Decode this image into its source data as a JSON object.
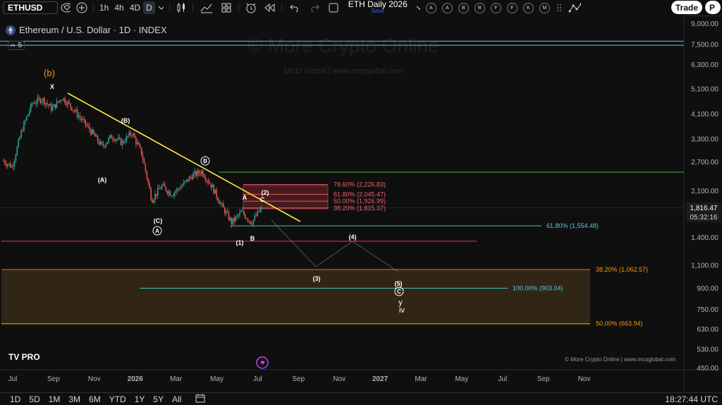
{
  "toolbar": {
    "symbol": "ETHUSD",
    "intervals": [
      "1h",
      "4h",
      "4D",
      "D"
    ],
    "layout_name": "ETH Daily 2026",
    "layout_status": "Save",
    "alert_buttons": [
      "A",
      "A",
      "B",
      "B",
      "F",
      "F",
      "K",
      "M"
    ],
    "trade_label": "Trade",
    "profile_label": "P",
    "icons": [
      "gem-icon",
      "add-compare-icon",
      "chevron-down-icon",
      "candles-icon",
      "indicators-icon",
      "templates-icon",
      "alert-icon",
      "replay-icon",
      "undo-icon",
      "redo-icon",
      "layout-icon",
      "chevron-down-icon",
      "dots-grid-icon",
      "trend-icon"
    ]
  },
  "legend": {
    "title": "Ethereum / U.S. Dollar · 1D · INDEX",
    "indicator_count": "5"
  },
  "watermark": {
    "main": "© More Crypto Online",
    "sub": "MCO Global  |  www.mcoglobal.com"
  },
  "chart_data": {
    "type": "candlestick",
    "title": "Ethereum / U.S. Dollar · 1D · INDEX",
    "y_scale": "log",
    "ylim": [
      440,
      9400
    ],
    "x_ticks": [
      "Jul",
      "Sep",
      "Nov",
      "2026",
      "Mar",
      "May",
      "Jul",
      "Sep",
      "Nov",
      "2027",
      "Mar",
      "May",
      "Jul",
      "Sep",
      "Nov"
    ],
    "y_ticks": [
      "9,000.00",
      "7,500.00",
      "6,300.00",
      "5,100.00",
      "4,100.00",
      "3,300.00",
      "2,700.00",
      "2,100.00",
      "1,400.00",
      "1,100.00",
      "900.00",
      "750.00",
      "630.00",
      "530.00",
      "450.00"
    ],
    "y_tick_values": [
      9000,
      7500,
      6300,
      5100,
      4100,
      3300,
      2700,
      2100,
      1400,
      1100,
      900,
      750,
      630,
      530,
      450
    ],
    "current_price": {
      "label": "1,816.47",
      "countdown": "05:32:16",
      "value": 1816.47
    },
    "price_path": [
      {
        "t": 0,
        "p": 2750
      },
      {
        "t": 1,
        "p": 2600
      },
      {
        "t": 2,
        "p": 3600
      },
      {
        "t": 3,
        "p": 4500
      },
      {
        "t": 4,
        "p": 4700
      },
      {
        "t": 5,
        "p": 4300
      },
      {
        "t": 6,
        "p": 4750
      },
      {
        "t": 7,
        "p": 4350
      },
      {
        "t": 8,
        "p": 3900
      },
      {
        "t": 9,
        "p": 3500
      },
      {
        "t": 10,
        "p": 3100
      },
      {
        "t": 11,
        "p": 3400
      },
      {
        "t": 12,
        "p": 3200
      },
      {
        "t": 13,
        "p": 3500
      },
      {
        "t": 14,
        "p": 2900
      },
      {
        "t": 15,
        "p": 1950
      },
      {
        "t": 16,
        "p": 2200
      },
      {
        "t": 17,
        "p": 2050
      },
      {
        "t": 18,
        "p": 2200
      },
      {
        "t": 19,
        "p": 2400
      },
      {
        "t": 20,
        "p": 2500
      },
      {
        "t": 21,
        "p": 2200
      },
      {
        "t": 22,
        "p": 1850
      },
      {
        "t": 23,
        "p": 1600
      },
      {
        "t": 24,
        "p": 1750
      },
      {
        "t": 25,
        "p": 1600
      },
      {
        "t": 26,
        "p": 1816
      }
    ],
    "fib_levels": [
      {
        "label": "78.60% (2,226.83)",
        "value": 2226.83,
        "color": "#f06070"
      },
      {
        "label": "61.80% (2,045.47)",
        "value": 2045.47,
        "color": "#f06070"
      },
      {
        "label": "50.00% (1,926.99)",
        "value": 1926.99,
        "color": "#f06070"
      },
      {
        "label": "38.20% (1,815.37)",
        "value": 1815.37,
        "color": "#f06070"
      },
      {
        "label": "61.80% (1,554.48)",
        "value": 1554.48,
        "color": "#4dd0e1"
      },
      {
        "label": "38.20% (1,062.57)",
        "value": 1062.57,
        "color": "#ff9800"
      },
      {
        "label": "100.00% (903.04)",
        "value": 903.04,
        "color": "#4dd0e1"
      },
      {
        "label": "50.00% (663.94)",
        "value": 663.94,
        "color": "#ff9800"
      }
    ],
    "horizontal_lines": [
      {
        "value": 7750,
        "color": "#4dd0e1"
      },
      {
        "value": 7480,
        "color": "#4dd0e1"
      },
      {
        "value": 2480,
        "color": "#4caf50"
      },
      {
        "value": 1360,
        "color": "#f23645"
      }
    ],
    "wave_labels": [
      {
        "text": "(b)",
        "color": "#ff9800"
      },
      {
        "text": "X",
        "color": "#ffffff"
      },
      {
        "text": "(B)",
        "color": "#ffffff"
      },
      {
        "text": "(A)",
        "color": "#ffffff"
      },
      {
        "text": "B",
        "color": "#ffffff",
        "circled": true
      },
      {
        "text": "(C)",
        "color": "#ffffff"
      },
      {
        "text": "A",
        "color": "#ffffff",
        "circled": true
      },
      {
        "text": "A",
        "color": "#ffffff"
      },
      {
        "text": "C",
        "color": "#ffffff"
      },
      {
        "text": "(2)",
        "color": "#ffffff"
      },
      {
        "text": "(1)",
        "color": "#ffffff"
      },
      {
        "text": "B",
        "color": "#ffffff"
      },
      {
        "text": "(4)",
        "color": "#ffffff"
      },
      {
        "text": "(3)",
        "color": "#ffffff"
      },
      {
        "text": "(5)",
        "color": "#ffffff"
      },
      {
        "text": "C",
        "color": "#ffffff",
        "circled": true
      },
      {
        "text": "y",
        "color": "#ffffff"
      },
      {
        "text": "iv",
        "color": "#ffffff"
      }
    ],
    "copyright": "© More Crypto Online  |  www.mcoglobal.com",
    "brand": "TV PRO"
  },
  "colors": {
    "up": "#26a69a",
    "down": "#ef5350",
    "trendline": "#ffeb3b",
    "background": "#0f0f0f"
  },
  "bottombar": {
    "timeframes": [
      "1D",
      "5D",
      "1M",
      "3M",
      "6M",
      "YTD",
      "1Y",
      "5Y",
      "All"
    ],
    "clock": "18:27:44 UTC",
    "icon": "date-range-icon"
  }
}
